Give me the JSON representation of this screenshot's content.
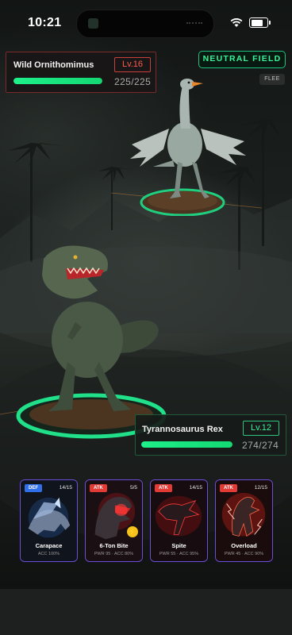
{
  "status_bar": {
    "time": "10:21"
  },
  "enemy": {
    "name": "Wild Ornithomimus",
    "level": "Lv.16",
    "hp_current": 225,
    "hp_max": 225,
    "hp_text": "225/225"
  },
  "field": {
    "label": "NEUTRAL FIELD"
  },
  "flee_label": "FLEE",
  "player": {
    "name": "Tyrannosaurus Rex",
    "level": "Lv.12",
    "hp_current": 274,
    "hp_max": 274,
    "hp_text": "274/274"
  },
  "moves": [
    {
      "type": "DEF",
      "uses": "14/15",
      "name": "Carapace",
      "stats": "ACC 100%",
      "accent": "#2f6fe8",
      "icon": "armored-beast-icon"
    },
    {
      "type": "ATK",
      "uses": "5/5",
      "name": "6-Ton Bite",
      "stats": "PWR 95 · ACC 80%",
      "accent": "#e23a34",
      "icon": "bite-icon"
    },
    {
      "type": "ATK",
      "uses": "14/15",
      "name": "Spite",
      "stats": "PWR 55 · ACC 95%",
      "accent": "#e23a34",
      "icon": "raptor-icon"
    },
    {
      "type": "ATK",
      "uses": "12/15",
      "name": "Overload",
      "stats": "PWR 45 · ACC 90%",
      "accent": "#e23a34",
      "icon": "lightning-raptor-icon"
    }
  ],
  "colors": {
    "hp_green": "#1ef08a",
    "enemy_accent": "#c8403c",
    "player_accent": "#2fc47e",
    "card_border": "#6c4fd8"
  }
}
